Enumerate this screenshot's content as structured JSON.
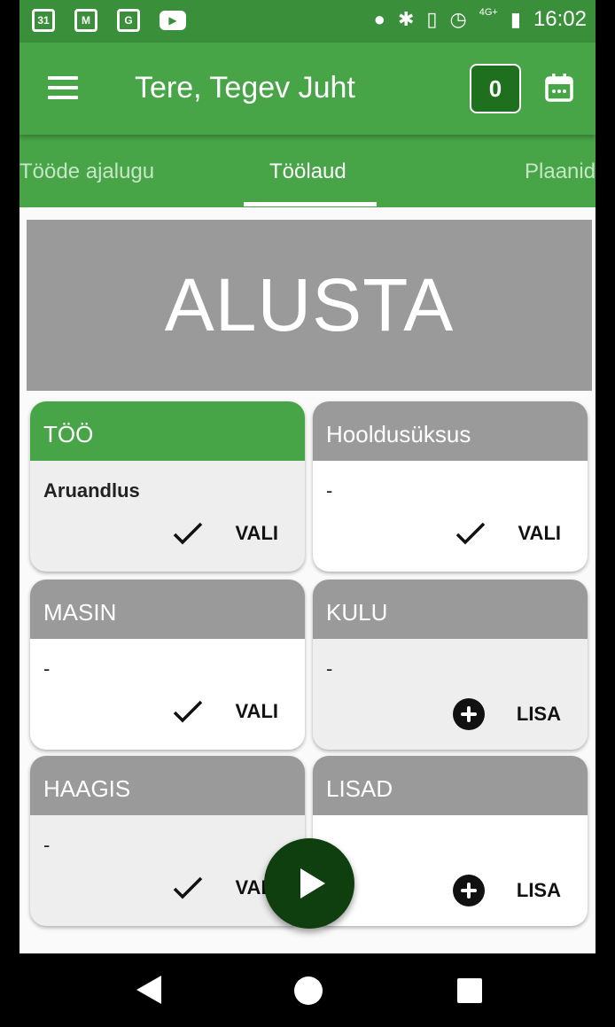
{
  "status_bar": {
    "time": "16:02",
    "left_icons": [
      "calendar-31-icon",
      "gmail-icon",
      "maps-icon",
      "youtube-icon"
    ],
    "calendar_day": "31",
    "right_icons": [
      "location-icon",
      "bluetooth-icon",
      "vibrate-icon",
      "alarm-icon",
      "signal-4g-icon",
      "battery-icon"
    ],
    "network_label": "4G+"
  },
  "app_bar": {
    "title": "Tere, Tegev Juht",
    "counter": "0",
    "colors": {
      "primary": "#47a447",
      "dark": "#1e6f1e"
    }
  },
  "tabs": [
    {
      "label": "Tööde ajalugu",
      "active": false
    },
    {
      "label": "Töölaud",
      "active": true
    },
    {
      "label": "Plaanid",
      "active": false
    }
  ],
  "start_banner": {
    "label": "ALUSTA"
  },
  "cards": [
    {
      "header": "TÖÖ",
      "value": "Aruandlus",
      "action": "VALI",
      "action_icon": "check-icon"
    },
    {
      "header": "Hooldusüksus",
      "value": "-",
      "action": "VALI",
      "action_icon": "check-icon"
    },
    {
      "header": "MASIN",
      "value": "-",
      "action": "VALI",
      "action_icon": "check-icon"
    },
    {
      "header": "KULU",
      "value": "-",
      "action": "LISA",
      "action_icon": "plus-circle-icon"
    },
    {
      "header": "HAAGIS",
      "value": "-",
      "action": "VALI",
      "action_icon": "check-icon"
    },
    {
      "header": "LISAD",
      "value": "",
      "action": "LISA",
      "action_icon": "plus-circle-icon"
    }
  ],
  "fab": {
    "icon": "play-icon"
  },
  "nav_bar": {
    "icons": [
      "back-icon",
      "home-icon",
      "recents-icon"
    ]
  }
}
